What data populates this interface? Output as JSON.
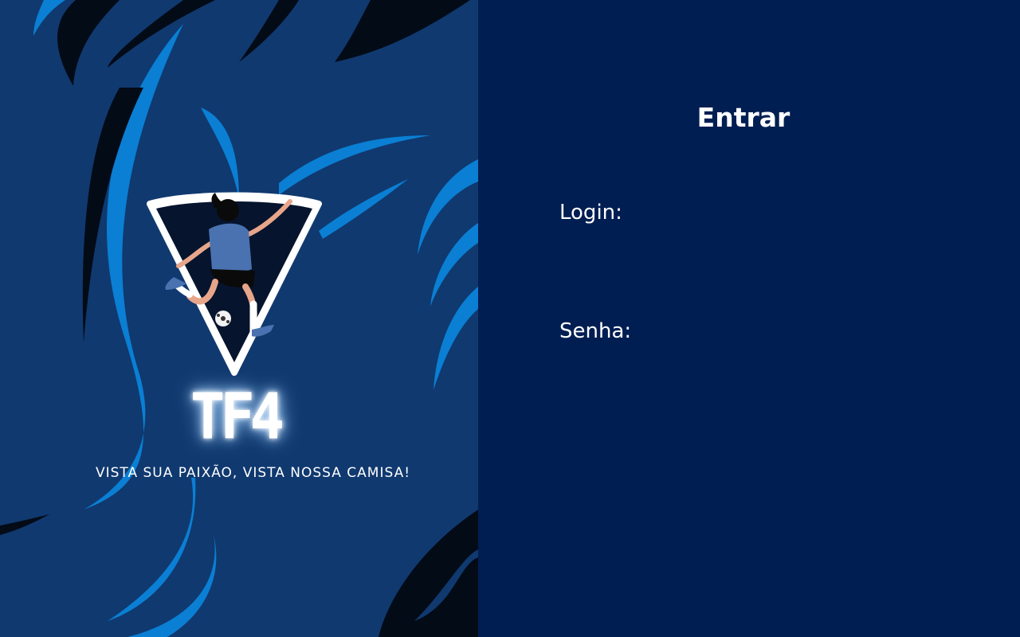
{
  "brand": {
    "logo_text": "TF4",
    "tagline": "VISTA SUA PAIXÃO, VISTA NOSSA CAMISA!"
  },
  "form": {
    "title": "Entrar",
    "login_label": "Login:",
    "login_value": "",
    "senha_label": "Senha:",
    "senha_value": ""
  },
  "colors": {
    "left_background": "#10396f",
    "right_background": "#001e52",
    "accent_blue": "#0a7fd4",
    "dark_stripe": "#030b17",
    "text": "#ffffff"
  },
  "icons": {
    "logo": "shield-soccer-player-icon"
  }
}
